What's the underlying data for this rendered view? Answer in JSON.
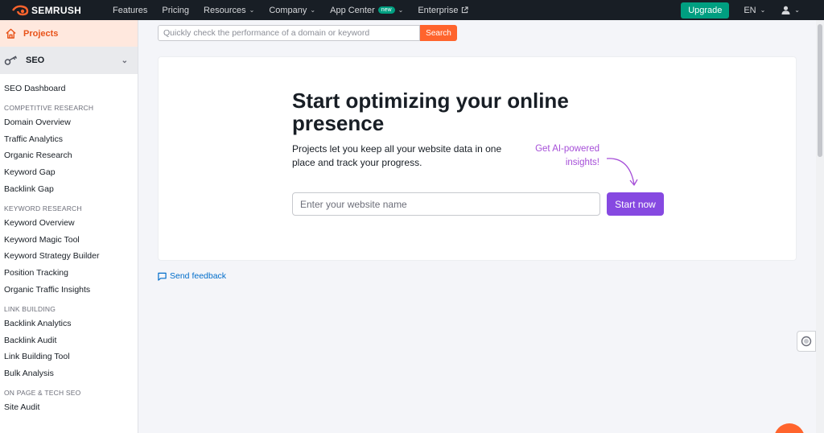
{
  "brand": {
    "name": "SEMRUSH",
    "accent": "#ff642d"
  },
  "nav": {
    "items": [
      {
        "label": "Features",
        "has_chevron": false
      },
      {
        "label": "Pricing",
        "has_chevron": false
      },
      {
        "label": "Resources",
        "has_chevron": true
      },
      {
        "label": "Company",
        "has_chevron": true
      },
      {
        "label": "App Center",
        "has_chevron": true,
        "badge": "new"
      },
      {
        "label": "Enterprise",
        "has_chevron": false,
        "external": true
      }
    ],
    "upgrade_label": "Upgrade",
    "language": "EN"
  },
  "sidebar": {
    "projects_label": "Projects",
    "seo_label": "SEO",
    "items": [
      {
        "type": "item",
        "label": "SEO Dashboard"
      },
      {
        "type": "heading",
        "label": "COMPETITIVE RESEARCH"
      },
      {
        "type": "item",
        "label": "Domain Overview"
      },
      {
        "type": "item",
        "label": "Traffic Analytics"
      },
      {
        "type": "item",
        "label": "Organic Research"
      },
      {
        "type": "item",
        "label": "Keyword Gap"
      },
      {
        "type": "item",
        "label": "Backlink Gap"
      },
      {
        "type": "heading",
        "label": "KEYWORD RESEARCH"
      },
      {
        "type": "item",
        "label": "Keyword Overview"
      },
      {
        "type": "item",
        "label": "Keyword Magic Tool"
      },
      {
        "type": "item",
        "label": "Keyword Strategy Builder"
      },
      {
        "type": "item",
        "label": "Position Tracking"
      },
      {
        "type": "item",
        "label": "Organic Traffic Insights"
      },
      {
        "type": "heading",
        "label": "LINK BUILDING"
      },
      {
        "type": "item",
        "label": "Backlink Analytics"
      },
      {
        "type": "item",
        "label": "Backlink Audit"
      },
      {
        "type": "item",
        "label": "Link Building Tool"
      },
      {
        "type": "item",
        "label": "Bulk Analysis"
      },
      {
        "type": "heading",
        "label": "ON PAGE & TECH SEO"
      },
      {
        "type": "item",
        "label": "Site Audit"
      }
    ]
  },
  "search": {
    "placeholder": "Quickly check the performance of a domain or keyword",
    "value": "",
    "button_label": "Search"
  },
  "main": {
    "title": "Start optimizing your online presence",
    "description": "Projects let you keep all your website data in one place and track your progress.",
    "ai_note": "Get AI-powered insights!",
    "website_placeholder": "Enter your website name",
    "website_value": "",
    "start_label": "Start now"
  },
  "feedback_label": "Send feedback"
}
